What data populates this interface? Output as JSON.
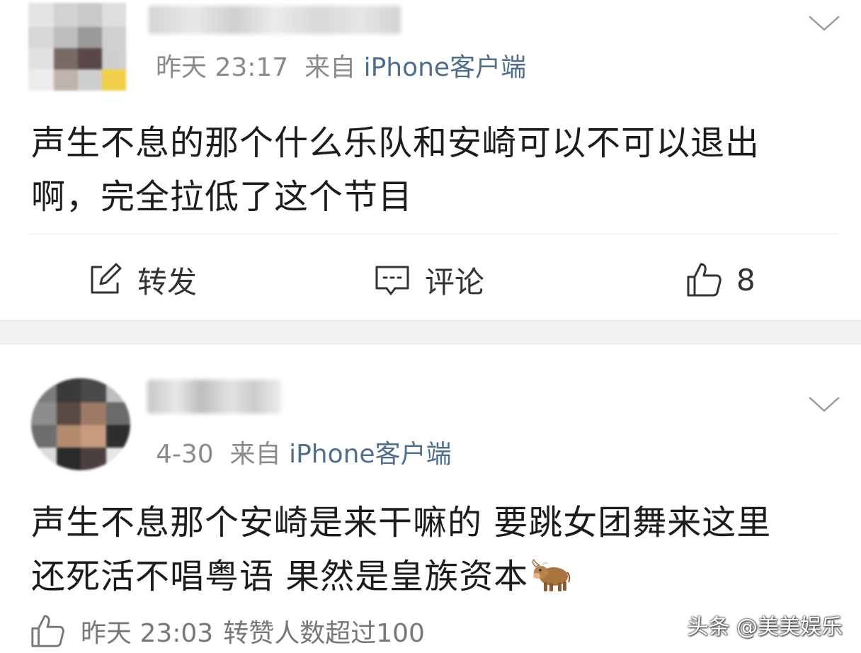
{
  "posts": [
    {
      "time": "昨天 23:17",
      "source_prefix": "来自",
      "source": "iPhone客户端",
      "content_lines": [
        "声生不息的那个什么乐队和安崎可以不可以退出",
        "啊，完全拉低了这个节目"
      ],
      "actions": {
        "repost_label": "转发",
        "comment_label": "评论",
        "like_count": "8"
      }
    },
    {
      "time": "4-30",
      "source_prefix": "来自",
      "source": "iPhone客户端",
      "content_lines": [
        "声生不息那个安崎是来干嘛的 要跳女团舞来这里",
        "还死活不唱粤语 果然是皇族资本"
      ],
      "footer": {
        "time": "昨天 23:03",
        "text": "转赞人数超过100"
      }
    }
  ],
  "watermark": "头条 @美美娱乐",
  "icons": {
    "more": "chevron-down-icon",
    "repost": "edit-square-icon",
    "comment": "comment-bubble-icon",
    "like": "thumbs-up-icon",
    "emoji": "ox-emoji-icon"
  },
  "colors": {
    "meta_gray": "#8a8a8a",
    "source_blue": "#4f6e8c",
    "text": "#1c1c1c",
    "separator": "#f1f1f1"
  }
}
